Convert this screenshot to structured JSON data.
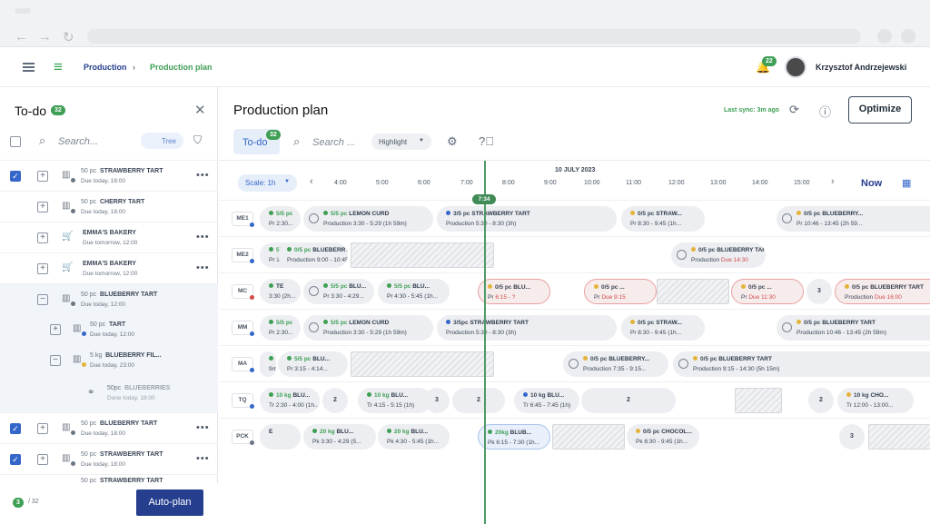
{
  "app": {
    "breadcrumb": [
      "Production",
      "Production plan"
    ],
    "notifications_count": "22",
    "user_name": "Krzysztof Andrzejewski"
  },
  "todo": {
    "title": "To-do",
    "count": "32",
    "search_placeholder": "Search...",
    "tree_label": "Tree",
    "items": [
      {
        "qty": "50 pc",
        "name": "STRAWBERRY TART",
        "due": "Due today, 18:00"
      },
      {
        "qty": "50 pc",
        "name": "CHERRY TART",
        "due": "Due today, 18:00"
      },
      {
        "qty": "",
        "name": "EMMA'S BAKERY",
        "due": "Due tomorrow, 12:00"
      },
      {
        "qty": "",
        "name": "EMMA'S BAKERY",
        "due": "Due tomorrow, 12:00"
      },
      {
        "qty": "50 pc",
        "name": "BLUEBERRY TART",
        "due": "Due today, 12:00"
      },
      {
        "qty": "50 pc",
        "name": "TART",
        "due": "Due today, 12:00"
      },
      {
        "qty": "5 kg",
        "name": "BLUEBERRY FIL...",
        "due": "Due today, 23:00"
      },
      {
        "qty": "50pc",
        "name": "BLUEBERRIES",
        "due": "Done today, 18:00"
      },
      {
        "qty": "50 pc",
        "name": "BLUEBERRY TART",
        "due": "Due today, 18:00"
      },
      {
        "qty": "50 pc",
        "name": "STRAWBERRY TART",
        "due": "Due today, 18:00"
      },
      {
        "qty": "50 pc",
        "name": "STRAWBERRY TART",
        "due": ""
      }
    ],
    "footer_selected": "3",
    "footer_total": "/ 32",
    "autoplan_label": "Auto-plan"
  },
  "plan": {
    "title": "Production plan",
    "last_sync": "Last sync: 3m ago",
    "optimize_label": "Optimize",
    "todo_tab": "To-do",
    "todo_count": "32",
    "search_placeholder": "Search ...",
    "highlight_label": "Highlight",
    "scale_label": "Scale: 1h",
    "date": "10 JULY 2023",
    "hours": [
      "4:00",
      "5:00",
      "6:00",
      "7:00",
      "8:00",
      "9:00",
      "10:00",
      "11:00",
      "12:00",
      "13:00",
      "14:00",
      "15:00"
    ],
    "now_label": "Now",
    "current_time": "7:34",
    "lanes": [
      {
        "id": "ME1",
        "bars": [
          {
            "q": "5/5 pc",
            "name": "",
            "sub": "Pr  2:30..."
          },
          {
            "q": "5/5 pc",
            "name": "LEMON CURD",
            "sub": "Production  3:30 - 5:29 (1h 59m)"
          },
          {
            "q": "3/5 pc",
            "name": "STRAWBERRY TART",
            "sub": "Production  5:30 - 8:30 (3h)"
          },
          {
            "q": "0/5 pc",
            "name": "STRAW...",
            "sub": "Pr  8:30 - 9:45 (1h..."
          },
          {
            "q": "0/5 pc",
            "name": "BLUEBERRY...",
            "sub": "Pr  10:46 - 13:45 (2h 59..."
          }
        ]
      },
      {
        "id": "ME2",
        "bars": [
          {
            "q": "5/5 pc",
            "name": "BLU...",
            "sub": "Pr  3:15 - 4:14..."
          },
          {
            "q": "0/5 pc",
            "name": "BLUEBERRY...",
            "sub": "Production  9:00 - 10:45 ("
          },
          {
            "q": "0/5 pc",
            "name": "BLUEBERRY TART",
            "sub": "Production",
            "due": "Due 14:30"
          }
        ]
      },
      {
        "id": "MC",
        "bars": [
          {
            "q": "",
            "name": "TE",
            "sub": "3:30 (2h..."
          },
          {
            "q": "5/5 pc",
            "name": "BLU...",
            "sub": "Pr  3:30 - 4:29..."
          },
          {
            "q": "5/5 pc",
            "name": "BLU...",
            "sub": "Pr  4:30 - 5:45 (1h..."
          },
          {
            "q": "0/5 pc",
            "name": "BLU...",
            "sub": "Pr",
            "due": "6:15 - ?"
          },
          {
            "q": "0/5 pc",
            "name": "...",
            "sub": "Pr",
            "due": "Due 9:15"
          },
          {
            "q": "0/5 pc",
            "name": "...",
            "sub": "Pr",
            "due": "Due 11:30"
          },
          {
            "q": "3",
            "name": "",
            "sub": ""
          },
          {
            "q": "0/5 pc",
            "name": "BLUEBERRY TART",
            "sub": "Production",
            "due": "Due 16:00"
          }
        ]
      },
      {
        "id": "MM",
        "bars": [
          {
            "q": "5/5 pc",
            "name": "",
            "sub": "Pr  2:30..."
          },
          {
            "q": "5/5 pc",
            "name": "LEMON CURD",
            "sub": "Production  3:30 - 5:29 (1h 59m)"
          },
          {
            "q": "3/5pc",
            "name": "STRAWBERRY TART",
            "sub": "Production  5:30 - 8:30 (3h)"
          },
          {
            "q": "0/5 pc",
            "name": "STRAW...",
            "sub": "Pr  8:30 - 9:45 (1h..."
          },
          {
            "q": "0/5 pc",
            "name": "BLUEBERRY TART",
            "sub": "Production  10:46 - 13:45 (2h 59m)"
          }
        ]
      },
      {
        "id": "MA",
        "bars": [
          {
            "q": "",
            "name": "RY...",
            "sub": "9m)"
          },
          {
            "q": "5/5 pc",
            "name": "BLU...",
            "sub": "Pr  3:15 - 4:14..."
          },
          {
            "q": "0/5 pc",
            "name": "BLUEBERRY...",
            "sub": "Production  7:35 - 9:15..."
          },
          {
            "q": "0/5 pc",
            "name": "BLUEBERRY TART",
            "sub": "Production  9:15 - 14:30 (5h 15m)"
          }
        ]
      },
      {
        "id": "TQ",
        "bars": [
          {
            "q": "10 kg",
            "name": "BLU...",
            "sub": "Tr  2:30 - 4:00 (1h..."
          },
          {
            "q": "2",
            "name": "",
            "sub": ""
          },
          {
            "q": "10 kg",
            "name": "BLU...",
            "sub": "Tr  4:15 - 5:15 (1h)"
          },
          {
            "q": "3",
            "name": "",
            "sub": ""
          },
          {
            "q": "2",
            "name": "",
            "sub": ""
          },
          {
            "q": "10 kg",
            "name": "BLU...",
            "sub": "Tr  6:45 - 7:45 (1h)"
          },
          {
            "q": "2",
            "name": "",
            "sub": ""
          },
          {
            "q": "2",
            "name": "",
            "sub": ""
          },
          {
            "q": "10 kg",
            "name": "CHO...",
            "sub": "Tr  12:00 - 13:00..."
          }
        ]
      },
      {
        "id": "PCK",
        "bars": [
          {
            "q": "",
            "name": "E",
            "sub": ""
          },
          {
            "q": "20 kg",
            "name": "BLU...",
            "sub": "Pk  3:30 - 4:29 (5..."
          },
          {
            "q": "20 kg",
            "name": "BLU...",
            "sub": "Pk  4:30 - 5:45 (1h..."
          },
          {
            "q": "20kg",
            "name": "BLUB...",
            "sub": "Pk  6:15 - 7:30 (1h..."
          },
          {
            "q": "0/5 pc",
            "name": "CHOCOL...",
            "sub": "Pk  8:30 - 9:45 (1h..."
          },
          {
            "q": "3",
            "name": "",
            "sub": ""
          }
        ]
      }
    ]
  },
  "colors": {
    "accent": "#3467c9",
    "primary_dark": "#253e8e",
    "green": "#3f9f55",
    "red": "#d24b4b",
    "yellow": "#e6b33a"
  }
}
